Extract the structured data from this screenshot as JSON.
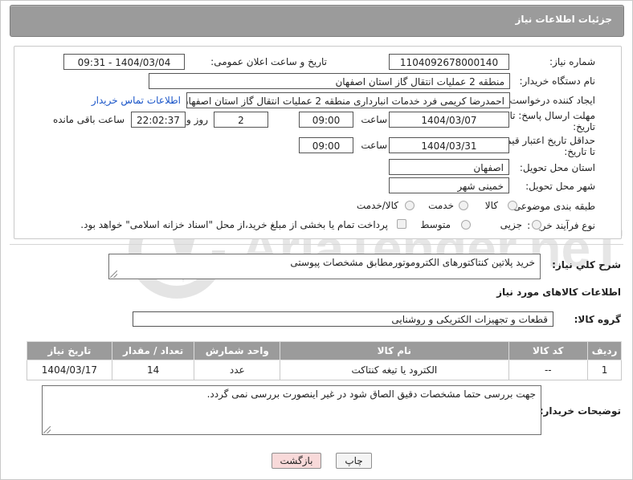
{
  "window": {
    "title": "جزئیات اطلاعات نیاز"
  },
  "fields": {
    "need_number": {
      "label": "شماره نیاز:",
      "value": "1104092678000140"
    },
    "announce_datetime": {
      "label": "تاریخ و ساعت اعلان عمومی:",
      "value": "1404/03/04 - 09:31"
    },
    "buyer_org": {
      "label": "نام دستگاه خریدار:",
      "value": "منطقه 2 عملیات انتقال گاز استان اصفهان"
    },
    "requester": {
      "label": "ایجاد کننده درخواست:",
      "value": "احمدرضا کریمی فرد خدمات انبارداری منطقه 2 عملیات انتقال گاز استان اصفهان",
      "contact_link": "اطلاعات تماس خریدار"
    },
    "reply_deadline": {
      "label_line1": "مهلت ارسال پاسخ: تا",
      "label_line2": "تاریخ:",
      "date": "1404/03/07",
      "time_label": "ساعت",
      "time": "09:00",
      "days": "2",
      "days_label": "روز و",
      "remaining": "22:02:37",
      "remaining_label": "ساعت باقی مانده"
    },
    "price_validity": {
      "label_line1": "حداقل تاریخ اعتبار قیمت:",
      "label_line2": "تا تاریخ:",
      "date": "1404/03/31",
      "time_label": "ساعت",
      "time": "09:00"
    },
    "delivery_province": {
      "label": "استان محل تحویل:",
      "value": "اصفهان"
    },
    "delivery_city": {
      "label": "شهر محل تحویل:",
      "value": "خمینی شهر"
    },
    "subject_class": {
      "label": "طبقه بندی موضوعی:",
      "options": [
        "کالا",
        "خدمت",
        "کالا/خدمت"
      ],
      "selected": "کالا"
    },
    "purchase_process": {
      "label": "نوع فرآیند خرید :",
      "options": [
        "جزیی",
        "متوسط"
      ],
      "selected": "جزیی",
      "payment_note": "پرداخت تمام یا بخشی از مبلغ خرید،از محل \"اسناد خزانه اسلامی\" خواهد بود."
    }
  },
  "description": {
    "label": "شرح کلي نياز:",
    "value": "خرید پلاتین کنتاکتورهای الکتروموتورمطابق مشخصات پیوستی"
  },
  "goods_section": {
    "title": "اطلاعات کالاهای مورد نیاز",
    "group_label": "گروه کالا:",
    "group_value": "قطعات و تجهیزات الکتریکی و روشنایی"
  },
  "table": {
    "headers": [
      "ردیف",
      "کد کالا",
      "نام کالا",
      "واحد شمارش",
      "تعداد / مقدار",
      "تاریخ نیاز"
    ],
    "rows": [
      [
        "1",
        "--",
        "الکترود یا تیغه کنتاکت",
        "عدد",
        "14",
        "1404/03/17"
      ]
    ]
  },
  "buyer_notes": {
    "label": "توضیحات خریدار:",
    "value": "جهت بررسی حتما مشخصات دقیق الصاق شود در غیر اینصورت بررسی نمی گردد."
  },
  "buttons": {
    "print": "چاپ",
    "back": "بازگشت"
  },
  "watermark": {
    "text": "AriaTender.neT"
  },
  "colors": {
    "title_bar": "#9b9b9b",
    "link": "#1a55c8",
    "back_button": "#f8d9d9",
    "watermark": "#e6e6e6"
  }
}
